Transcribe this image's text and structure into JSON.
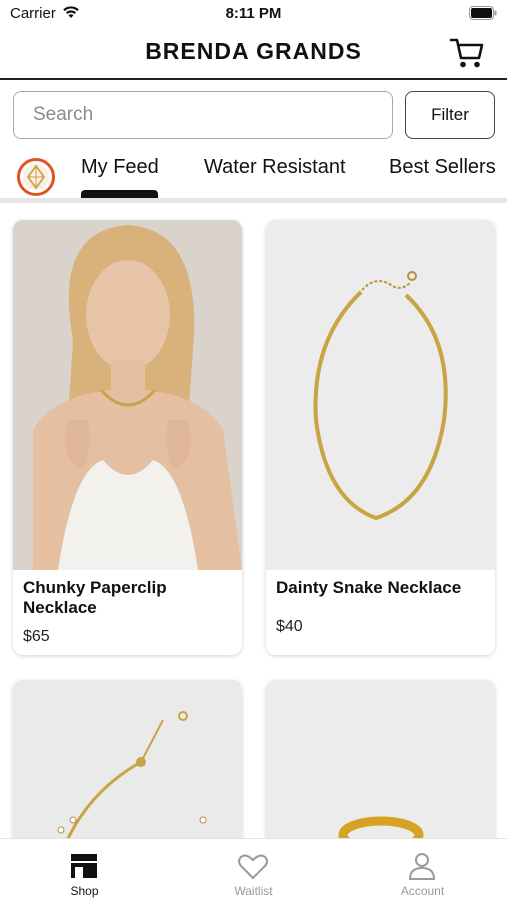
{
  "status_bar": {
    "carrier": "Carrier",
    "time": "8:11 PM"
  },
  "header": {
    "title": "BRENDA GRANDS"
  },
  "search": {
    "placeholder": "Search",
    "filter_label": "Filter"
  },
  "tabs": [
    {
      "label": "My Feed",
      "active": true
    },
    {
      "label": "Water Resistant",
      "active": false
    },
    {
      "label": "Best Sellers",
      "active": false
    }
  ],
  "products": [
    {
      "name": "Chunky Paperclip Necklace",
      "price": "$65"
    },
    {
      "name": "Dainty Snake Necklace",
      "price": "$40"
    }
  ],
  "bottom_nav": [
    {
      "label": "Shop",
      "active": true
    },
    {
      "label": "Waitlist",
      "active": false
    },
    {
      "label": "Account",
      "active": false
    }
  ],
  "colors": {
    "accent": "#111111",
    "inactive": "#9a9a9a",
    "gold": "#c9a445",
    "logo_ring": "#e2531f"
  }
}
